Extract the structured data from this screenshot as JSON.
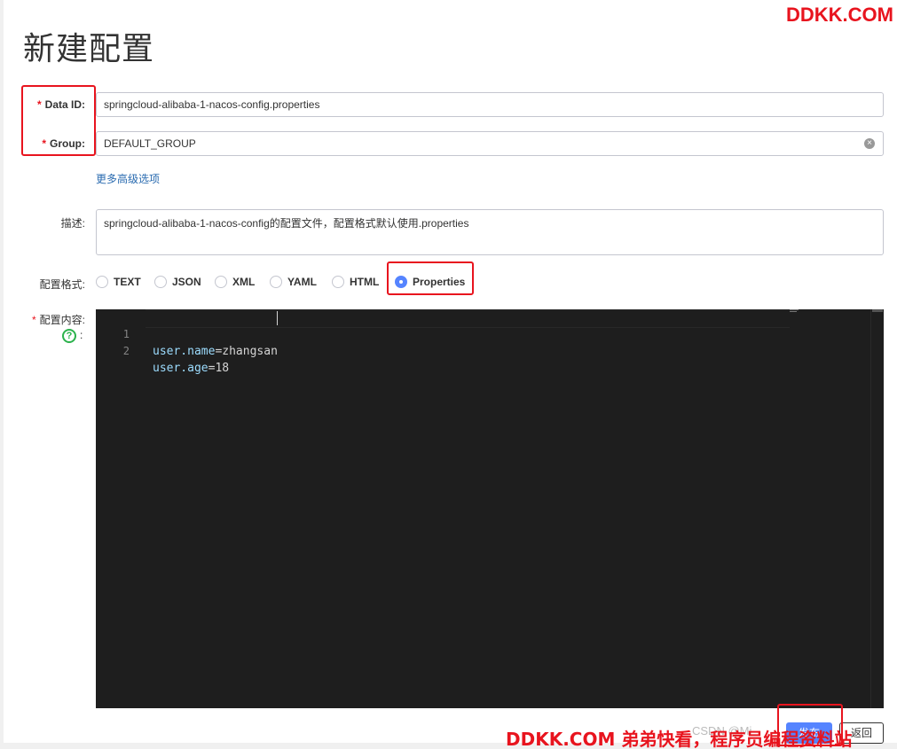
{
  "page": {
    "title": "新建配置"
  },
  "watermark": {
    "top": "DDKK.COM",
    "bottom": "DDKK.COM 弟弟快看，程序员编程资料站",
    "csdn": "CSDN @Mi"
  },
  "form": {
    "data_id": {
      "required_mark": "*",
      "label": "Data ID:",
      "value": "springcloud-alibaba-1-nacos-config.properties"
    },
    "group": {
      "required_mark": "*",
      "label": "Group:",
      "value": "DEFAULT_GROUP"
    },
    "advanced_link": "更多高级选项",
    "description": {
      "label": "描述:",
      "value": "springcloud-alibaba-1-nacos-config的配置文件，配置格式默认使用.properties"
    },
    "format": {
      "label": "配置格式:",
      "options": [
        "TEXT",
        "JSON",
        "XML",
        "YAML",
        "HTML",
        "Properties"
      ],
      "selected": "Properties"
    },
    "content": {
      "required_mark": "*",
      "label": "配置内容:",
      "help_colon": ":",
      "lines": [
        {
          "number": "1",
          "key": "user.name",
          "eq": "=",
          "value": "zhangsan"
        },
        {
          "number": "2",
          "key": "user.age",
          "eq": "=",
          "value": "18"
        }
      ]
    }
  },
  "buttons": {
    "publish": "发布",
    "back": "返回"
  },
  "colors": {
    "required": "#e8141e",
    "primary": "#5584ff",
    "editor_bg": "#1e1e1e",
    "help": "#2bb24c",
    "link": "#2a6bb0"
  }
}
